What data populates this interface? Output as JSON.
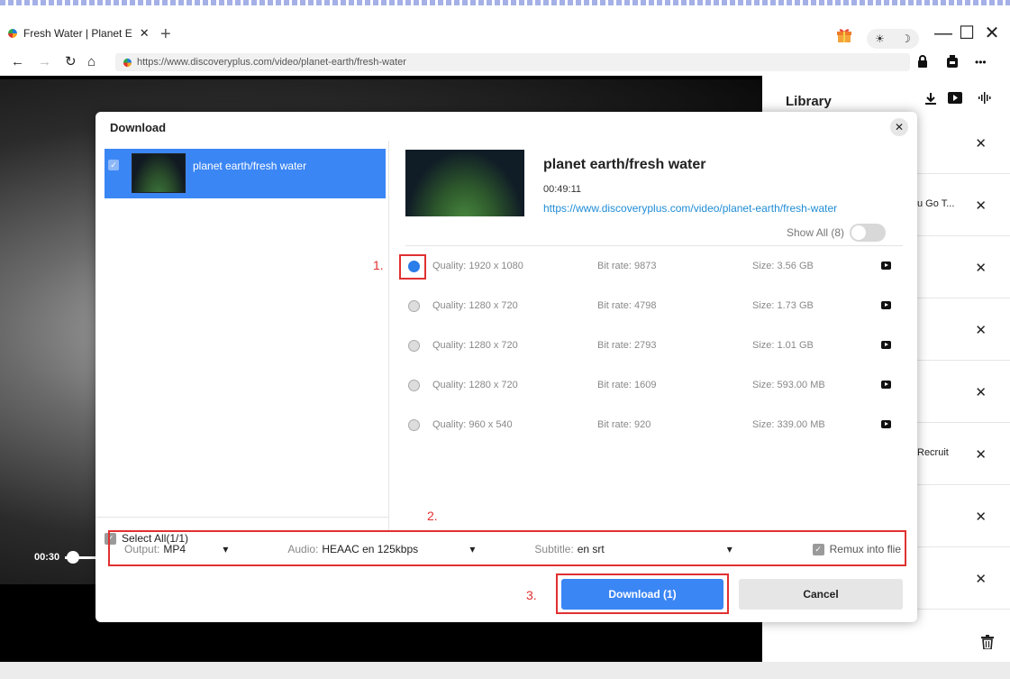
{
  "browser": {
    "tab_title": "Fresh Water | Planet E",
    "tab_close": "✕",
    "new_tab": "+",
    "theme_sun": "☀",
    "theme_moon": "☽",
    "minimize": "—",
    "maximize": "☐",
    "close": "✕",
    "url": "https://www.discoveryplus.com/video/planet-earth/fresh-water",
    "more": "•••"
  },
  "colors": {
    "accent": "#3b86f5",
    "link": "#1f8cd6",
    "annotation": "#e03030"
  },
  "player": {
    "time": "00:30"
  },
  "library": {
    "title": "Library",
    "items": [
      {
        "text": ""
      },
      {
        "text": "u Go T..."
      },
      {
        "text": ""
      },
      {
        "text": ""
      },
      {
        "text": ""
      },
      {
        "text": "Recruit"
      },
      {
        "text": ""
      },
      {
        "text": ""
      }
    ]
  },
  "modal": {
    "title": "Download",
    "video": {
      "title": "planet earth/fresh water",
      "duration": "00:49:11",
      "url": "https://www.discoveryplus.com/video/planet-earth/fresh-water"
    },
    "show_all": "Show All (8)",
    "select_all": "Select All(1/1)",
    "qualities": [
      {
        "quality": "Quality: 1920 x 1080",
        "bitrate": "Bit rate: 9873",
        "size": "Size: 3.56 GB",
        "selected": true
      },
      {
        "quality": "Quality: 1280 x 720",
        "bitrate": "Bit rate: 4798",
        "size": "Size: 1.73 GB",
        "selected": false
      },
      {
        "quality": "Quality: 1280 x 720",
        "bitrate": "Bit rate: 2793",
        "size": "Size: 1.01 GB",
        "selected": false
      },
      {
        "quality": "Quality: 1280 x 720",
        "bitrate": "Bit rate: 1609",
        "size": "Size: 593.00 MB",
        "selected": false
      },
      {
        "quality": "Quality: 960 x 540",
        "bitrate": "Bit rate: 920",
        "size": "Size: 339.00 MB",
        "selected": false
      }
    ],
    "options": {
      "output_label": "Output:",
      "output_value": "MP4",
      "audio_label": "Audio:",
      "audio_value": "HEAAC en 125kbps",
      "subtitle_label": "Subtitle:",
      "subtitle_value": "en srt",
      "remux_label": "Remux into flie"
    },
    "download_button": "Download (1)",
    "cancel_button": "Cancel",
    "close": "✕"
  },
  "annotations": {
    "one": "1.",
    "two": "2.",
    "three": "3."
  }
}
